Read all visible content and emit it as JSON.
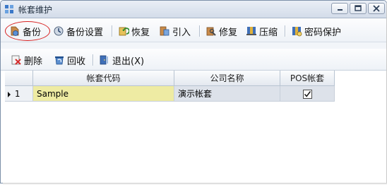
{
  "window": {
    "title": "帐套维护"
  },
  "toolbar": {
    "row1": [
      {
        "label": "备份",
        "icon": "backup-icon"
      },
      {
        "label": "备份设置",
        "icon": "backup-settings-icon"
      },
      {
        "label": "恢复",
        "icon": "restore-icon"
      },
      {
        "label": "引入",
        "icon": "import-icon"
      },
      {
        "label": "修复",
        "icon": "repair-icon"
      },
      {
        "label": "压缩",
        "icon": "compress-icon"
      },
      {
        "label": "密码保护",
        "icon": "password-protect-icon"
      }
    ],
    "row2": [
      {
        "label": "删除",
        "icon": "delete-icon"
      },
      {
        "label": "回收",
        "icon": "recycle-icon"
      },
      {
        "label": "退出(X)",
        "icon": "exit-icon"
      }
    ]
  },
  "grid": {
    "columns": [
      "帐套代码",
      "公司名称",
      "POS帐套"
    ],
    "rows": [
      {
        "index": "1",
        "code": "Sample",
        "company": "演示帐套",
        "pos": true
      }
    ]
  },
  "colors": {
    "selected_cell": "#eeeba3",
    "row_cell": "#dde2ea",
    "annotation_circle": "#d82020"
  }
}
